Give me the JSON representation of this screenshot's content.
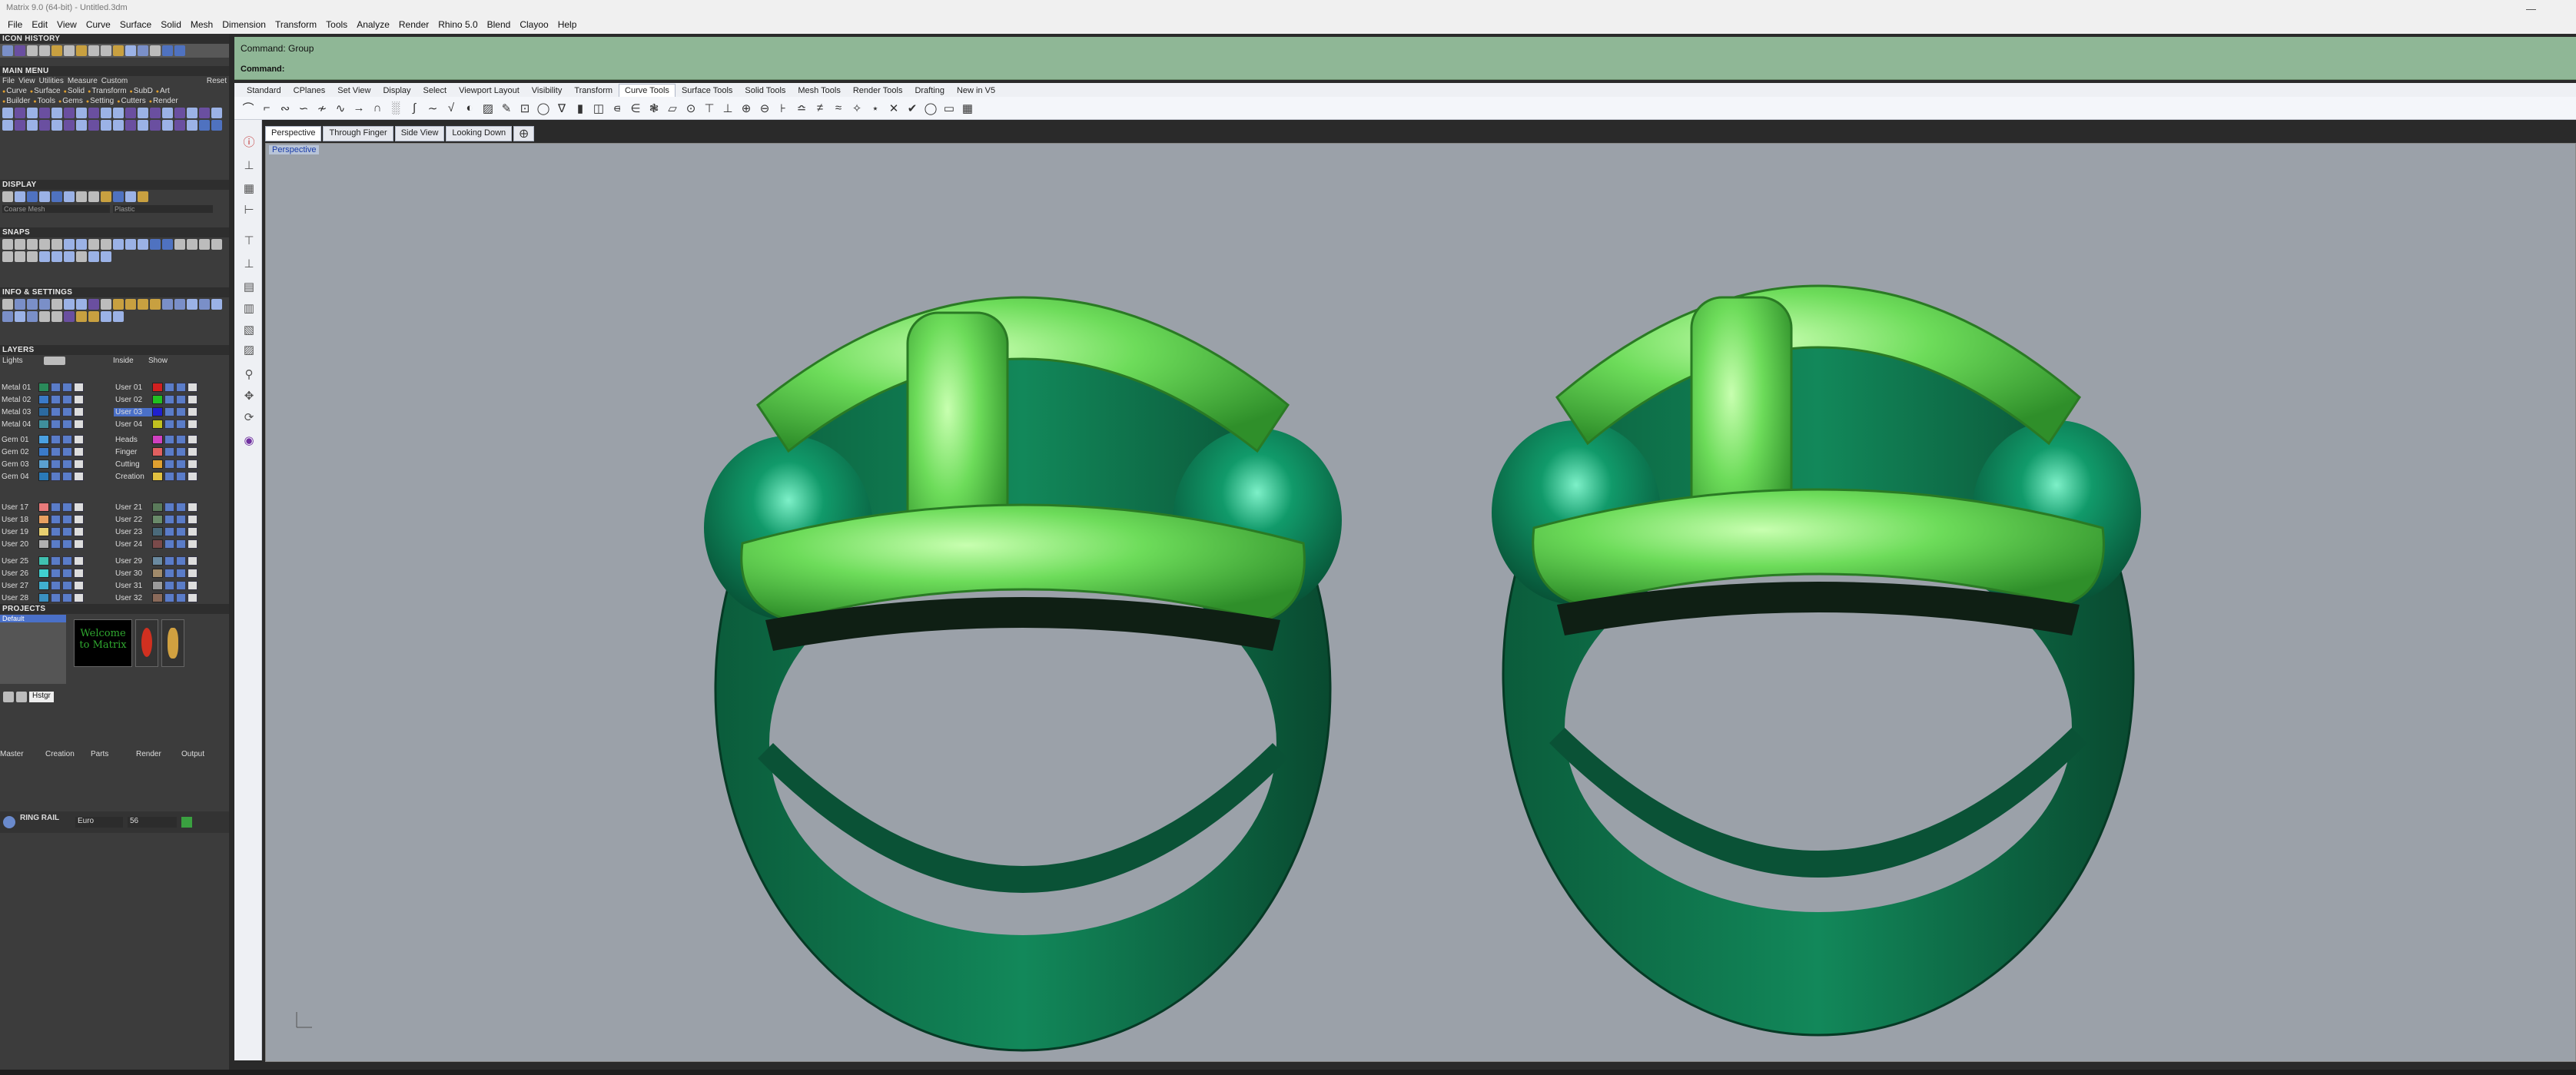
{
  "window": {
    "title": "Matrix 9.0 (64-bit) - Untitled.3dm"
  },
  "menubar": [
    "File",
    "Edit",
    "View",
    "Curve",
    "Surface",
    "Solid",
    "Mesh",
    "Dimension",
    "Transform",
    "Tools",
    "Analyze",
    "Render",
    "Rhino 5.0",
    "Blend",
    "Clayoo",
    "Help"
  ],
  "left_panel": {
    "icon_history": "ICON HISTORY",
    "main_menu": "MAIN MENU",
    "main_menu_items": [
      "File",
      "View",
      "Utilities",
      "Measure",
      "Custom"
    ],
    "reset": "Reset",
    "tabs_row1": [
      "Curve",
      "Surface",
      "Solid",
      "Transform",
      "SubD",
      "Art"
    ],
    "tabs_row2": [
      "Builder",
      "Tools",
      "Gems",
      "Setting",
      "Cutters",
      "Render"
    ],
    "display": "DISPLAY",
    "display_selects": [
      "Coarse Mesh",
      "Plastic"
    ],
    "snaps": "SNAPS",
    "info_settings": "INFO & SETTINGS",
    "layers": "LAYERS",
    "layers_top": {
      "lights": "Lights",
      "inside": "Inside",
      "show": "Show"
    },
    "layers_left": [
      "Metal 01",
      "Metal 02",
      "Metal 03",
      "Metal 04",
      "Gem 01",
      "Gem 02",
      "Gem 03",
      "Gem 04",
      "User 17",
      "User 18",
      "User 19",
      "User 20",
      "User 25",
      "User 26",
      "User 27",
      "User 28"
    ],
    "layers_right": [
      "User 01",
      "User 02",
      "User 03",
      "User 04",
      "Heads",
      "Finger",
      "Cutting",
      "Creation",
      "User 21",
      "User 22",
      "User 23",
      "User 24",
      "User 29",
      "User 30",
      "User 31",
      "User 32"
    ],
    "projects": "PROJECTS",
    "project_default": "Default",
    "welcome_text": "Welcome to Matrix",
    "history_label": "Hstgr",
    "bottom_tabs": [
      "Master",
      "Creation",
      "Parts",
      "Render",
      "Output"
    ],
    "ring_rail": "RING RAIL",
    "ring_standard": "Euro",
    "ring_size": "56"
  },
  "command": {
    "line1": "Command: Group",
    "line2": "Command:"
  },
  "toolbar_tabs": [
    "Standard",
    "CPlanes",
    "Set View",
    "Display",
    "Select",
    "Viewport Layout",
    "Visibility",
    "Transform",
    "Curve Tools",
    "Surface Tools",
    "Solid Tools",
    "Mesh Tools",
    "Render Tools",
    "Drafting",
    "New in V5"
  ],
  "viewport_tabs": [
    "Perspective",
    "Through Finger",
    "Side View",
    "Looking Down"
  ],
  "viewport": {
    "label": "Perspective"
  },
  "colors": {
    "command_bg": "#8fb796",
    "viewport_bg": "#9ba1a9",
    "ring_band": "#0f6b45",
    "braid": "#6ddc5a"
  }
}
